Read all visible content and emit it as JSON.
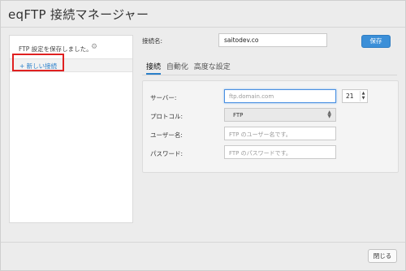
{
  "window": {
    "title": "eqFTP 接続マネージャー"
  },
  "sidebar": {
    "save_message": "FTP 設定を保存しました。",
    "gear_icon": "gear-icon",
    "new_connection": "+ 新しい接続"
  },
  "connection": {
    "label": "接続名:",
    "value": "saitodev.co"
  },
  "buttons": {
    "save": "保存",
    "close": "閉じる"
  },
  "tabs": [
    "接続",
    "自動化",
    "高度な設定"
  ],
  "form": {
    "server": {
      "label": "サーバー:",
      "placeholder": "ftp.domain.com",
      "port": "21"
    },
    "protocol": {
      "label": "プロトコル:",
      "value": "FTP"
    },
    "username": {
      "label": "ユーザー名:",
      "placeholder": "FTP のユーザー名です。"
    },
    "password": {
      "label": "パスワード:",
      "placeholder": "FTP のパスワードです。"
    }
  },
  "colors": {
    "accent": "#3b8fd8",
    "link": "#2a7fc9",
    "highlight": "#e02020"
  }
}
